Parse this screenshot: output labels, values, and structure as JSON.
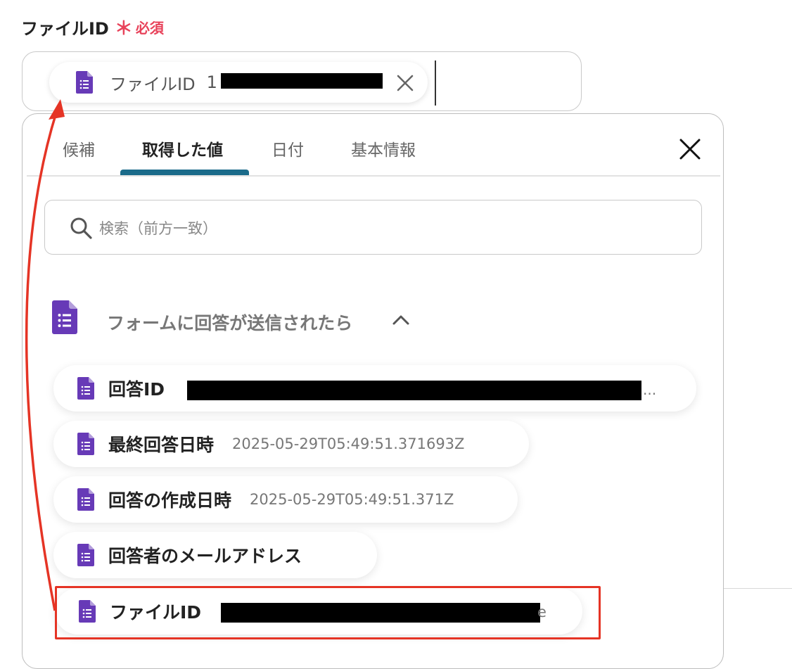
{
  "field": {
    "label": "ファイルID",
    "required_star": "＊",
    "required_text": "必須",
    "chip_label": "ファイルID",
    "chip_value_visible": "1"
  },
  "tabs": [
    {
      "label": "候補",
      "active": false
    },
    {
      "label": "取得した値",
      "active": true
    },
    {
      "label": "日付",
      "active": false
    },
    {
      "label": "基本情報",
      "active": false
    }
  ],
  "search": {
    "placeholder": "検索（前方一致）"
  },
  "section": {
    "title": "フォームに回答が送信されたら"
  },
  "items": [
    {
      "label": "回答ID",
      "value": "",
      "ellipsis": "..."
    },
    {
      "label": "最終回答日時",
      "value": "2025-05-29T05:49:51.371693Z"
    },
    {
      "label": "回答の作成日時",
      "value": "2025-05-29T05:49:51.371Z"
    },
    {
      "label": "回答者のメールアドレス",
      "value": ""
    },
    {
      "label": "ファイルID",
      "value": "",
      "tail": "e"
    }
  ],
  "colors": {
    "accent_tab": "#1b6b8a",
    "required": "#e8425a",
    "forms_purple": "#673ab7",
    "highlight": "#e53425"
  },
  "icons": [
    "google-forms-icon",
    "close-icon",
    "search-icon",
    "chevron-up-icon"
  ]
}
